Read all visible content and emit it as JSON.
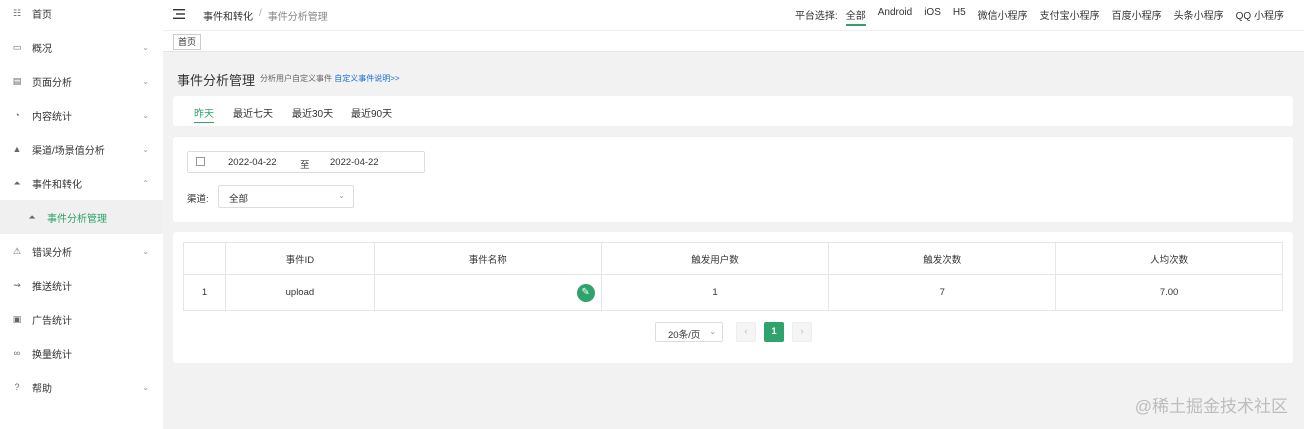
{
  "sidebar": {
    "items": [
      {
        "label": "首页",
        "icon": "dashboard-icon",
        "arrow": ""
      },
      {
        "label": "概况",
        "icon": "overview-icon",
        "arrow": "⌄"
      },
      {
        "label": "页面分析",
        "icon": "page-icon",
        "arrow": "⌄"
      },
      {
        "label": "内容统计",
        "icon": "pie-icon",
        "arrow": "⌄"
      },
      {
        "label": "渠道/场景值分析",
        "icon": "channel-icon",
        "arrow": "⌄"
      },
      {
        "label": "事件和转化",
        "icon": "flask-icon",
        "arrow": "⌃"
      },
      {
        "label": "事件分析管理",
        "icon": "flask-icon",
        "arrow": ""
      },
      {
        "label": "错误分析",
        "icon": "warning-icon",
        "arrow": "⌄"
      },
      {
        "label": "推送统计",
        "icon": "push-icon",
        "arrow": ""
      },
      {
        "label": "广告统计",
        "icon": "ad-icon",
        "arrow": ""
      },
      {
        "label": "换量统计",
        "icon": "link-icon",
        "arrow": ""
      },
      {
        "label": "帮助",
        "icon": "help-icon",
        "arrow": "⌄"
      }
    ]
  },
  "breadcrumb": {
    "parent": "事件和转化",
    "sep": "/",
    "current": "事件分析管理"
  },
  "platforms": {
    "label": "平台选择:",
    "options": [
      "全部",
      "Android",
      "iOS",
      "H5",
      "微信小程序",
      "支付宝小程序",
      "百度小程序",
      "头条小程序",
      "QQ 小程序"
    ]
  },
  "tag": "首页",
  "page": {
    "title": "事件分析管理",
    "sub": "分析用户自定义事件",
    "link": "自定义事件说明>>"
  },
  "tabs": [
    "昨天",
    "最近七天",
    "最近30天",
    "最近90天"
  ],
  "filter": {
    "date_start": "2022-04-22",
    "to": "至",
    "date_end": "2022-04-22",
    "channel_label": "渠道:",
    "channel_value": "全部"
  },
  "table": {
    "headers": [
      "",
      "事件ID",
      "事件名称",
      "触发用户数",
      "触发次数",
      "人均次数"
    ],
    "rows": [
      [
        "1",
        "upload",
        "",
        "1",
        "7",
        "7.00"
      ]
    ]
  },
  "pager": {
    "size": "20条/页",
    "prev": "‹",
    "current": "1",
    "next": "›"
  },
  "watermark": "@稀土掘金技术社区",
  "colors": {
    "accent": "#2fa36b",
    "link": "#1a6fd6"
  }
}
